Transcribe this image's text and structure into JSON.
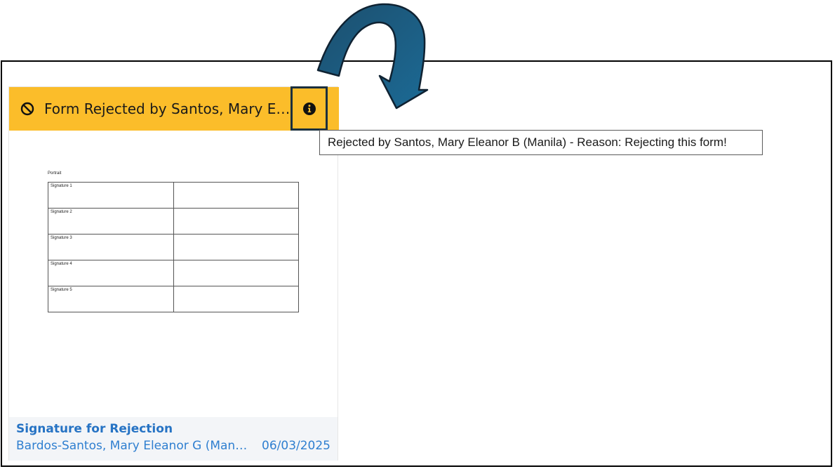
{
  "card": {
    "header_text": "Form Rejected by Santos, Mary Eleanor B (Manila)",
    "header_color": "#fbbd2a",
    "status_icon": "block-icon",
    "info_icon": "info-icon"
  },
  "tooltip": {
    "text": "Rejected by Santos, Mary Eleanor B (Manila) - Reason: Rejecting this form!"
  },
  "document": {
    "title": "Portrait",
    "rows": [
      {
        "label": "Signature 1",
        "value": ""
      },
      {
        "label": "Signature 2",
        "value": ""
      },
      {
        "label": "Signature 3",
        "value": ""
      },
      {
        "label": "Signature 4",
        "value": ""
      },
      {
        "label": "Signature 5",
        "value": ""
      }
    ]
  },
  "footer": {
    "title": "Signature for Rejection",
    "name": "Bardos-Santos, Mary Eleanor G (Manila)",
    "date": "06/03/2025"
  },
  "annotation": {
    "arrow_icon": "curved-arrow-icon",
    "arrow_color": "#1a5a80"
  }
}
